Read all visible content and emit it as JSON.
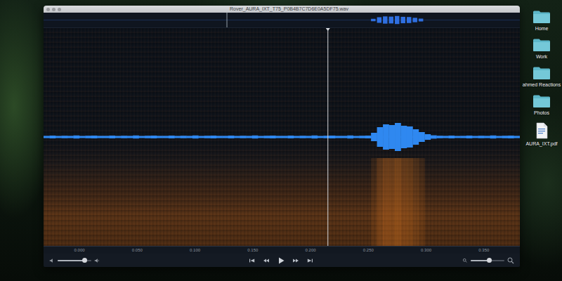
{
  "window": {
    "title": "Rover_AURA_IXT_T75_P0B4B7C7D6E0A5DF75.wav"
  },
  "overview": {
    "level": 0.385
  },
  "waveform": {
    "samples": [
      0.08,
      0.1,
      0.07,
      0.09,
      0.08,
      0.11,
      0.07,
      0.09,
      0.1,
      0.08,
      0.08,
      0.1,
      0.07,
      0.09,
      0.08,
      0.11,
      0.07,
      0.09,
      0.1,
      0.08,
      0.08,
      0.1,
      0.07,
      0.09,
      0.08,
      0.11,
      0.07,
      0.09,
      0.1,
      0.08,
      0.08,
      0.1,
      0.07,
      0.09,
      0.08,
      0.11,
      0.07,
      0.09,
      0.1,
      0.08,
      0.08,
      0.1,
      0.07,
      0.09,
      0.08,
      0.11,
      0.07,
      0.09,
      0.1,
      0.08,
      0.08,
      0.11,
      0.07,
      0.09,
      0.1,
      0.3,
      0.7,
      0.9,
      0.85,
      1,
      0.8,
      0.75,
      0.55,
      0.35,
      0.2,
      0.12,
      0.09,
      0.08,
      0.1,
      0.07,
      0.08,
      0.1,
      0.07,
      0.09,
      0.08,
      0.11,
      0.07,
      0.09,
      0.1,
      0.08
    ]
  },
  "playhead": {
    "level": 0.597
  },
  "ruler": {
    "ticks": [
      "0.000",
      "0.050",
      "0.100",
      "0.150",
      "0.200",
      "0.250",
      "0.300",
      "0.350"
    ]
  },
  "volume": {
    "level": 0.8
  },
  "zoom": {
    "level": 0.55
  },
  "desktop": {
    "items": [
      {
        "label": "Home",
        "kind": "folder"
      },
      {
        "label": "Work",
        "kind": "folder"
      },
      {
        "label": "ahmed Reactions",
        "kind": "folder"
      },
      {
        "label": "Photos",
        "kind": "folder"
      },
      {
        "label": "AURA_IXT.pdf",
        "kind": "file"
      }
    ]
  }
}
